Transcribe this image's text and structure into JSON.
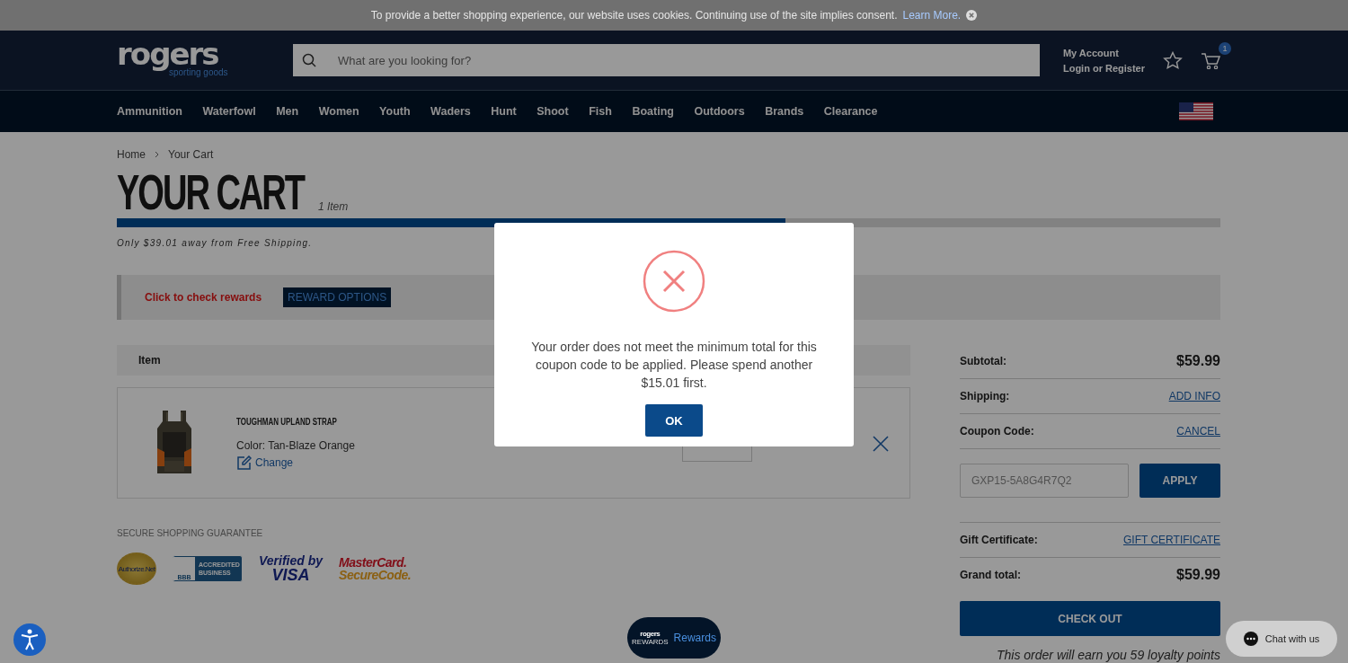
{
  "cookie_banner": {
    "text": "To provide a better shopping experience, our website uses cookies. Continuing use of the site implies consent.",
    "link": "Learn More."
  },
  "header": {
    "logo": {
      "name": "rogers",
      "tagline": "sporting goods"
    },
    "search": {
      "placeholder": "What are you looking for?"
    },
    "account": {
      "title": "My Account",
      "link": "Login or Register"
    },
    "cart_count": "1"
  },
  "nav": [
    {
      "label": "Ammunition"
    },
    {
      "label": "Waterfowl"
    },
    {
      "label": "Men"
    },
    {
      "label": "Women"
    },
    {
      "label": "Youth"
    },
    {
      "label": "Waders"
    },
    {
      "label": "Hunt"
    },
    {
      "label": "Shoot"
    },
    {
      "label": "Fish"
    },
    {
      "label": "Boating"
    },
    {
      "label": "Outdoors"
    },
    {
      "label": "Brands"
    },
    {
      "label": "Clearance"
    }
  ],
  "breadcrumb": [
    "Home",
    "Your Cart"
  ],
  "cart": {
    "title": "YOUR CART",
    "count": "1 Item",
    "shipping_progress": {
      "level": 0.606,
      "message": "Only $39.01 away from Free Shipping."
    }
  },
  "rewards_bar": {
    "text": "Click to check rewards",
    "button": "REWARD OPTIONS"
  },
  "items_table": {
    "columns": [
      "Item"
    ],
    "rows": [
      {
        "name": "TOUGHMAN UPLAND STRAP",
        "variant": "Color: Tan-Blaze Orange",
        "change": "Change"
      }
    ]
  },
  "secure": {
    "title": "SECURE SHOPPING GUARANTEE",
    "badges": [
      {
        "kind": "authorize",
        "texts": [
          "Authorize.Net"
        ]
      },
      {
        "kind": "bbb",
        "texts": [
          "BBB",
          "ACCREDITED BUSINESS"
        ]
      },
      {
        "kind": "visa",
        "texts": [
          "Verified by",
          "VISA"
        ]
      },
      {
        "kind": "mastercard",
        "texts": [
          "MasterCard.",
          "SecureCode."
        ]
      }
    ]
  },
  "summary": {
    "rows": [
      {
        "kind": "amount",
        "label": "Subtotal:",
        "value": "$59.99"
      },
      {
        "kind": "link",
        "label": "Shipping:",
        "value": "ADD INFO"
      },
      {
        "kind": "link",
        "label": "Coupon Code:",
        "value": "CANCEL"
      },
      {
        "kind": "coupon",
        "placeholder": "GXP15-5A8G4R7Q2",
        "button": "APPLY"
      },
      {
        "kind": "link",
        "label": "Gift Certificate:",
        "value": "GIFT CERTIFICATE"
      },
      {
        "kind": "amount",
        "label": "Grand total:",
        "value": "$59.99"
      }
    ],
    "checkout": "CHECK OUT",
    "loyalty": "This order will earn you 59 loyalty points"
  },
  "modal": {
    "message": "Your order does not meet the minimum total for this coupon code to be applied. Please spend another $15.01 first.",
    "button": "OK"
  },
  "rewards_launcher": {
    "logo": "rogers",
    "logo_sub": "REWARDS",
    "label": "Rewards"
  },
  "chat": {
    "label": "Chat with us"
  }
}
